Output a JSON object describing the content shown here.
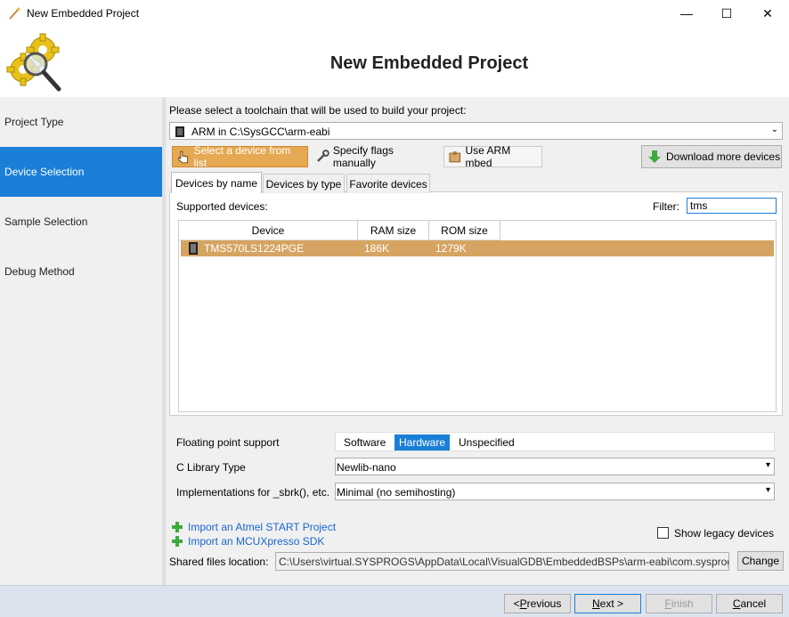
{
  "window": {
    "title": "New Embedded Project",
    "minimize": "—",
    "maximize": "☐",
    "close": "✕"
  },
  "header": {
    "heading": "New Embedded Project"
  },
  "sidebar": {
    "items": [
      {
        "label": "Project Type",
        "active": false
      },
      {
        "label": "Device Selection",
        "active": true
      },
      {
        "label": "Sample Selection",
        "active": false
      },
      {
        "label": "Debug Method",
        "active": false
      }
    ]
  },
  "toolchain": {
    "prompt": "Please select a toolchain that will be used to build your project:",
    "selected": "ARM in C:\\SysGCC\\arm-eabi"
  },
  "toolbar": {
    "select_from_list": "Select a device from list",
    "specify_flags": "Specify flags manually",
    "use_mbed": "Use ARM mbed",
    "download_more": "Download more devices"
  },
  "tabs": {
    "by_name": "Devices by name",
    "by_type": "Devices by type",
    "favorites": "Favorite devices"
  },
  "devices": {
    "supported_label": "Supported devices:",
    "filter_label": "Filter:",
    "filter_value": "tms",
    "columns": [
      "Device",
      "RAM size",
      "ROM size"
    ],
    "rows": [
      {
        "device": "TMS570LS1224PGE",
        "ram": "186K",
        "rom": "1279K",
        "selected": true
      }
    ]
  },
  "options": {
    "fp_label": "Floating point support",
    "fp_options": [
      "Software",
      "Hardware",
      "Unspecified"
    ],
    "fp_selected": "Hardware",
    "clib_label": "C Library Type",
    "clib_value": "Newlib-nano",
    "sbrk_label": "Implementations for _sbrk(), etc.",
    "sbrk_value": "Minimal (no semihosting)"
  },
  "links": {
    "atmel": "Import an Atmel START Project",
    "mcux": "Import an MCUXpresso SDK"
  },
  "legacy": {
    "label": "Show legacy devices",
    "checked": false
  },
  "shared": {
    "label": "Shared files location:",
    "path": "C:\\Users\\virtual.SYSPROGS\\AppData\\Local\\VisualGDB\\EmbeddedBSPs\\arm-eabi\\com.sysprogs.a",
    "change": "Change"
  },
  "nav": {
    "previous_pre": "< ",
    "previous_u": "P",
    "previous_post": "revious",
    "next_u": "N",
    "next_post": "ext >",
    "finish_u": "F",
    "finish_post": "inish",
    "cancel_u": "C",
    "cancel_post": "ancel"
  },
  "colors": {
    "accent": "#1a7fd6",
    "selected_row": "#d6a462",
    "active_tool": "#e6a953",
    "link": "#1a66cc"
  }
}
